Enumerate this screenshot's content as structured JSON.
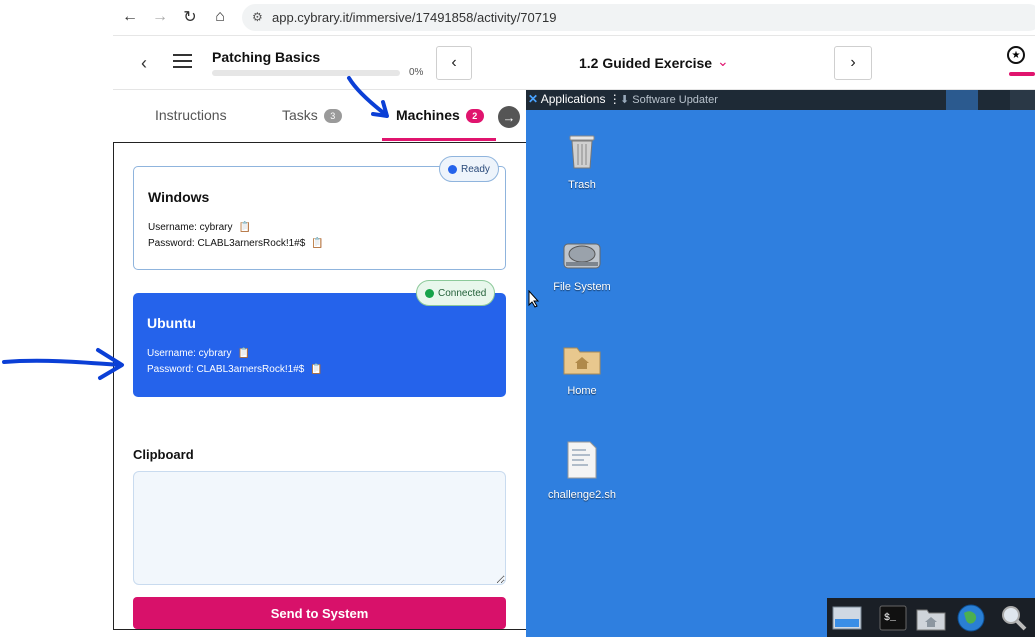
{
  "browser": {
    "url": "app.cybrary.it/immersive/17491858/activity/70719"
  },
  "header": {
    "course_title": "Patching Basics",
    "progress_label": "0%",
    "progress_value": 0,
    "exercise_title": "1.2 Guided Exercise"
  },
  "tabs": [
    {
      "label": "Instructions"
    },
    {
      "label": "Tasks",
      "badge": "3"
    },
    {
      "label": "Machines",
      "badge": "2"
    }
  ],
  "machines": [
    {
      "name": "Windows",
      "status": "Ready",
      "username_line": "Username: cybrary",
      "password_line": "Password: CLABL3arnersRock!1#$"
    },
    {
      "name": "Ubuntu",
      "status": "Connected",
      "username_line": "Username: cybrary",
      "password_line": "Password: CLABL3arnersRock!1#$"
    }
  ],
  "clipboard": {
    "label": "Clipboard",
    "value": ""
  },
  "send_button": "Send to System",
  "desktop": {
    "apps_menu": "Applications",
    "updater": "Software Updater",
    "icons": [
      {
        "label": "Trash",
        "icon": "trash-icon"
      },
      {
        "label": "File System",
        "icon": "drive-icon"
      },
      {
        "label": "Home",
        "icon": "folder-icon"
      },
      {
        "label": "challenge2.sh",
        "icon": "script-file-icon"
      }
    ],
    "dock": [
      "desktop-icon",
      "terminal-icon",
      "file-manager-icon",
      "web-browser-icon",
      "search-icon"
    ]
  },
  "colors": {
    "accent": "#e0146e",
    "selected_card": "#2563eb",
    "desktop_bg": "#2f7fdf",
    "ready_dot": "#2563eb",
    "connected_dot": "#16a34a"
  }
}
